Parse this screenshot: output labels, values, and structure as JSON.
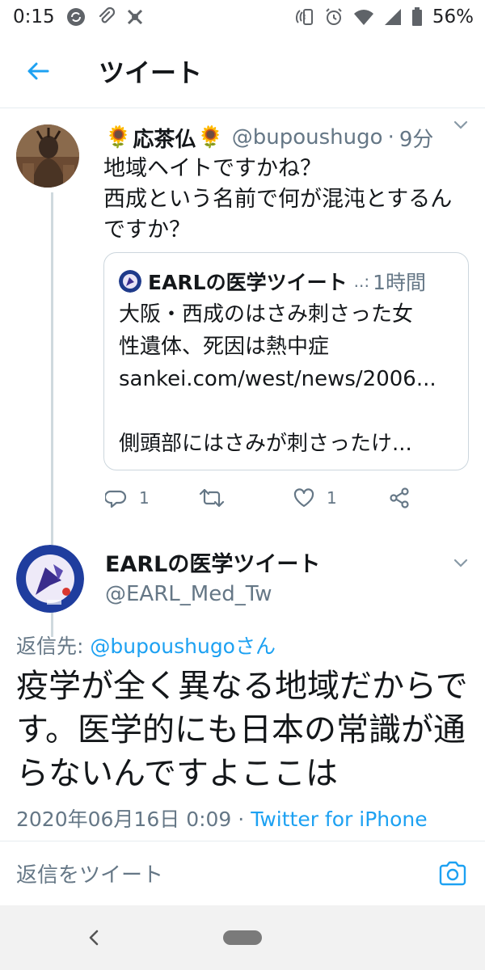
{
  "status_bar": {
    "time": "0:15",
    "battery": "56%"
  },
  "header": {
    "title": "ツイート"
  },
  "parent_tweet": {
    "name": "応茶仏",
    "name_emoji": "🌻",
    "handle": "@bupoushugo",
    "separator": "·",
    "time": "9分",
    "text": "地域ヘイトですかね？\n西成という名前で何が混沌とするんですか？",
    "quoted": {
      "name": "EARLの医学ツイート",
      "truncation": "..:",
      "time": "1時間",
      "lines": [
        "大阪・西成のはさみ刺さった女",
        "性遺体、死因は熱中症",
        "sankei.com/west/news/2006...",
        "",
        "側頭部にはさみが刺さったけ..."
      ]
    },
    "actions": {
      "reply_count": "1",
      "like_count": "1"
    }
  },
  "main_tweet": {
    "name": "EARLの医学ツイート",
    "handle": "@EARL_Med_Tw",
    "reply_to_prefix": "返信先: ",
    "reply_to_mention": "@bupoushugoさん",
    "text": "疫学が全く異なる地域だからです。医学的にも日本の常識が通らないんですよここは",
    "date": "2020年06月16日 0:09",
    "separator": " · ",
    "source": "Twitter for iPhone"
  },
  "composer": {
    "placeholder": "返信をツイート"
  },
  "colors": {
    "accent": "#1da1f2",
    "secondary_text": "#657786",
    "primary_text": "#14171a"
  }
}
